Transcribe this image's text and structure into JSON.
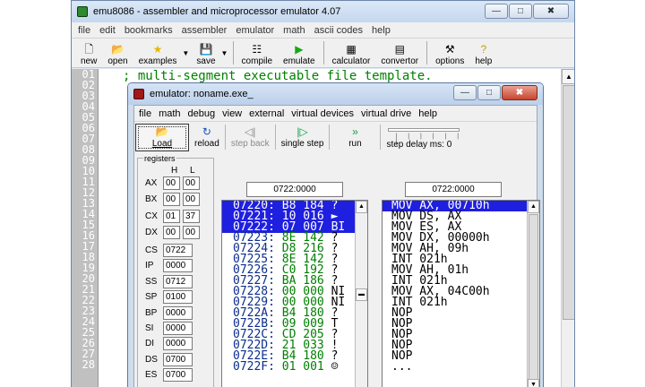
{
  "main": {
    "title": "emu8086 - assembler and microprocessor emulator 4.07",
    "menu": [
      "file",
      "edit",
      "bookmarks",
      "assembler",
      "emulator",
      "math",
      "ascii codes",
      "help"
    ],
    "toolbar": [
      {
        "label": "new",
        "icon": "new-file-icon",
        "glyph": "🗋"
      },
      {
        "label": "open",
        "icon": "open-folder-icon",
        "glyph": "📂"
      },
      {
        "label": "examples",
        "icon": "star-icon",
        "glyph": "★"
      },
      {
        "label": "save",
        "icon": "floppy-icon",
        "glyph": "💾"
      },
      {
        "label": "compile",
        "icon": "compile-icon",
        "glyph": "☷"
      },
      {
        "label": "emulate",
        "icon": "play-icon",
        "glyph": "▶"
      },
      {
        "label": "calculator",
        "icon": "calculator-icon",
        "glyph": "▦"
      },
      {
        "label": "convertor",
        "icon": "convertor-icon",
        "glyph": "▤"
      },
      {
        "label": "options",
        "icon": "tools-icon",
        "glyph": "⚒"
      },
      {
        "label": "help",
        "icon": "help-icon",
        "glyph": "?"
      }
    ],
    "line_numbers": [
      "01",
      "02",
      "03",
      "04",
      "05",
      "06",
      "07",
      "08",
      "09",
      "10",
      "11",
      "12",
      "13",
      "14",
      "15",
      "16",
      "17",
      "18",
      "19",
      "20",
      "21",
      "22",
      "23",
      "24",
      "25",
      "26",
      "27",
      "28"
    ],
    "code_line": "; multi-segment executable file template."
  },
  "emulator": {
    "title": "emulator: noname.exe_",
    "menu": [
      "file",
      "math",
      "debug",
      "view",
      "external",
      "virtual devices",
      "virtual drive",
      "help"
    ],
    "toolbar": [
      {
        "label": "Load",
        "icon": "load-folder-icon",
        "glyph": "📂"
      },
      {
        "label": "reload",
        "icon": "reload-icon",
        "glyph": "↻"
      },
      {
        "label": "step back",
        "icon": "step-back-icon",
        "glyph": "◁|"
      },
      {
        "label": "single step",
        "icon": "single-step-icon",
        "glyph": "|▷"
      },
      {
        "label": "run",
        "icon": "run-icon",
        "glyph": "»"
      }
    ],
    "step_delay_label": "step delay ms: 0",
    "registers_caption": "registers",
    "h_label": "H",
    "l_label": "L",
    "gp_registers": [
      {
        "name": "AX",
        "h": "00",
        "l": "00"
      },
      {
        "name": "BX",
        "h": "00",
        "l": "00"
      },
      {
        "name": "CX",
        "h": "01",
        "l": "37"
      },
      {
        "name": "DX",
        "h": "00",
        "l": "00"
      }
    ],
    "seg_registers": [
      {
        "name": "CS",
        "value": "0722"
      },
      {
        "name": "IP",
        "value": "0000"
      },
      {
        "name": "SS",
        "value": "0712"
      },
      {
        "name": "SP",
        "value": "0100"
      },
      {
        "name": "BP",
        "value": "0000"
      },
      {
        "name": "SI",
        "value": "0000"
      },
      {
        "name": "DI",
        "value": "0000"
      },
      {
        "name": "DS",
        "value": "0700"
      },
      {
        "name": "ES",
        "value": "0700"
      }
    ],
    "mem_address": "0722:0000",
    "dis_address": "0722:0000",
    "memory": [
      {
        "addr": "07220:",
        "hex": "B8",
        "dec": "184",
        "ch": "?",
        "selected": true
      },
      {
        "addr": "07221:",
        "hex": "10",
        "dec": "016",
        "ch": "►",
        "selected": true
      },
      {
        "addr": "07222:",
        "hex": "07",
        "dec": "007",
        "ch": "BI",
        "selected": true
      },
      {
        "addr": "07223:",
        "hex": "8E",
        "dec": "142",
        "ch": "?",
        "selected": false
      },
      {
        "addr": "07224:",
        "hex": "D8",
        "dec": "216",
        "ch": "?",
        "selected": false
      },
      {
        "addr": "07225:",
        "hex": "8E",
        "dec": "142",
        "ch": "?",
        "selected": false
      },
      {
        "addr": "07226:",
        "hex": "C0",
        "dec": "192",
        "ch": "?",
        "selected": false
      },
      {
        "addr": "07227:",
        "hex": "BA",
        "dec": "186",
        "ch": "?",
        "selected": false
      },
      {
        "addr": "07228:",
        "hex": "00",
        "dec": "000",
        "ch": "NI",
        "selected": false
      },
      {
        "addr": "07229:",
        "hex": "00",
        "dec": "000",
        "ch": "NI",
        "selected": false
      },
      {
        "addr": "0722A:",
        "hex": "B4",
        "dec": "180",
        "ch": "?",
        "selected": false
      },
      {
        "addr": "0722B:",
        "hex": "09",
        "dec": "009",
        "ch": "T",
        "selected": false
      },
      {
        "addr": "0722C:",
        "hex": "CD",
        "dec": "205",
        "ch": "?",
        "selected": false
      },
      {
        "addr": "0722D:",
        "hex": "21",
        "dec": "033",
        "ch": "!",
        "selected": false
      },
      {
        "addr": "0722E:",
        "hex": "B4",
        "dec": "180",
        "ch": "?",
        "selected": false
      },
      {
        "addr": "0722F:",
        "hex": "01",
        "dec": "001",
        "ch": "☺",
        "selected": false
      }
    ],
    "disassembly": [
      {
        "text": "MOV AX, 00710h",
        "selected": true
      },
      {
        "text": "MOV DS, AX",
        "selected": false
      },
      {
        "text": "MOV ES, AX",
        "selected": false
      },
      {
        "text": "MOV DX, 00000h",
        "selected": false
      },
      {
        "text": "MOV AH, 09h",
        "selected": false
      },
      {
        "text": "INT 021h",
        "selected": false
      },
      {
        "text": "MOV AH, 01h",
        "selected": false
      },
      {
        "text": "INT 021h",
        "selected": false
      },
      {
        "text": "MOV AX, 04C00h",
        "selected": false
      },
      {
        "text": "INT 021h",
        "selected": false
      },
      {
        "text": "NOP",
        "selected": false
      },
      {
        "text": "NOP",
        "selected": false
      },
      {
        "text": "NOP",
        "selected": false
      },
      {
        "text": "NOP",
        "selected": false
      },
      {
        "text": "NOP",
        "selected": false
      },
      {
        "text": "...",
        "selected": false
      }
    ]
  }
}
